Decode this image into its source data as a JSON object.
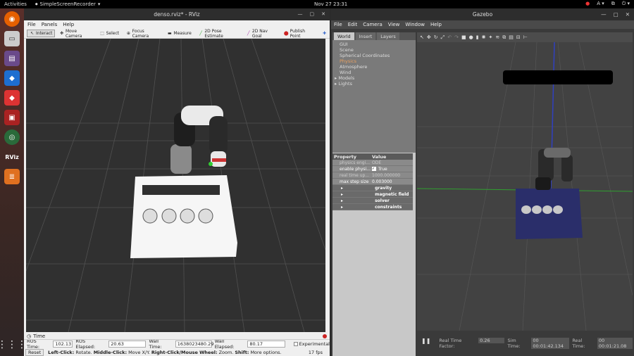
{
  "topbar": {
    "activities": "Activities",
    "app_name": "SimpleScreenRecorder",
    "clock": "Nov 27  23:31"
  },
  "dock": {
    "items": [
      "firefox-icon",
      "files-icon",
      "media-icon",
      "vscode-icon",
      "anydesk-icon",
      "monitor-icon",
      "camera-icon",
      "rviz-icon",
      "layers-icon"
    ],
    "rviz_label": "RViz"
  },
  "rviz": {
    "title": "denso.rviz* - RViz",
    "menu": [
      "File",
      "Panels",
      "Help"
    ],
    "tools": [
      "Interact",
      "Move Camera",
      "Select",
      "Focus Camera",
      "Measure",
      "2D Pose Estimate",
      "2D Nav Goal",
      "Publish Point"
    ],
    "time_panel": {
      "title": "Time",
      "ros_time_label": "ROS Time:",
      "ros_time": "102.13",
      "ros_elapsed_label": "ROS Elapsed:",
      "ros_elapsed": "20.63",
      "wall_time_label": "Wall Time:",
      "wall_time": "1638023480.29",
      "wall_elapsed_label": "Wall Elapsed:",
      "wall_elapsed": "80.17",
      "experimental": "Experimental"
    },
    "help": {
      "reset": "Reset",
      "left_click": "Left-Click:",
      "left_text": "Rotate.",
      "middle_click": "Middle-Click:",
      "middle_text": "Move X/Y.",
      "right_click": "Right-Click/Mouse Wheel:",
      "right_text": "Zoom.",
      "shift": "Shift:",
      "shift_text": "More options.",
      "fps": "17 fps"
    }
  },
  "gazebo": {
    "title": "Gazebo",
    "menu": [
      "File",
      "Edit",
      "Camera",
      "View",
      "Window",
      "Help"
    ],
    "tabs": [
      "World",
      "Insert",
      "Layers"
    ],
    "tree": [
      "GUI",
      "Scene",
      "Spherical Coordinates",
      "Physics",
      "Atmosphere",
      "Wind",
      "Models",
      "Lights"
    ],
    "props_header": [
      "Property",
      "Value"
    ],
    "props": [
      {
        "k": "physics engi...",
        "v": "ODE"
      },
      {
        "k": "enable physi...",
        "v": "True"
      },
      {
        "k": "real time up...",
        "v": "1000.000000"
      },
      {
        "k": "max step size",
        "v": "0.003000"
      }
    ],
    "groups": [
      "gravity",
      "magnetic field",
      "solver",
      "constraints"
    ],
    "status": {
      "rtf_label": "Real Time Factor:",
      "rtf": "0.26",
      "sim_label": "Sim Time:",
      "sim": "00 00:01:42.134",
      "real_label": "Real Time:",
      "real": "00 00:01:21.08"
    }
  }
}
